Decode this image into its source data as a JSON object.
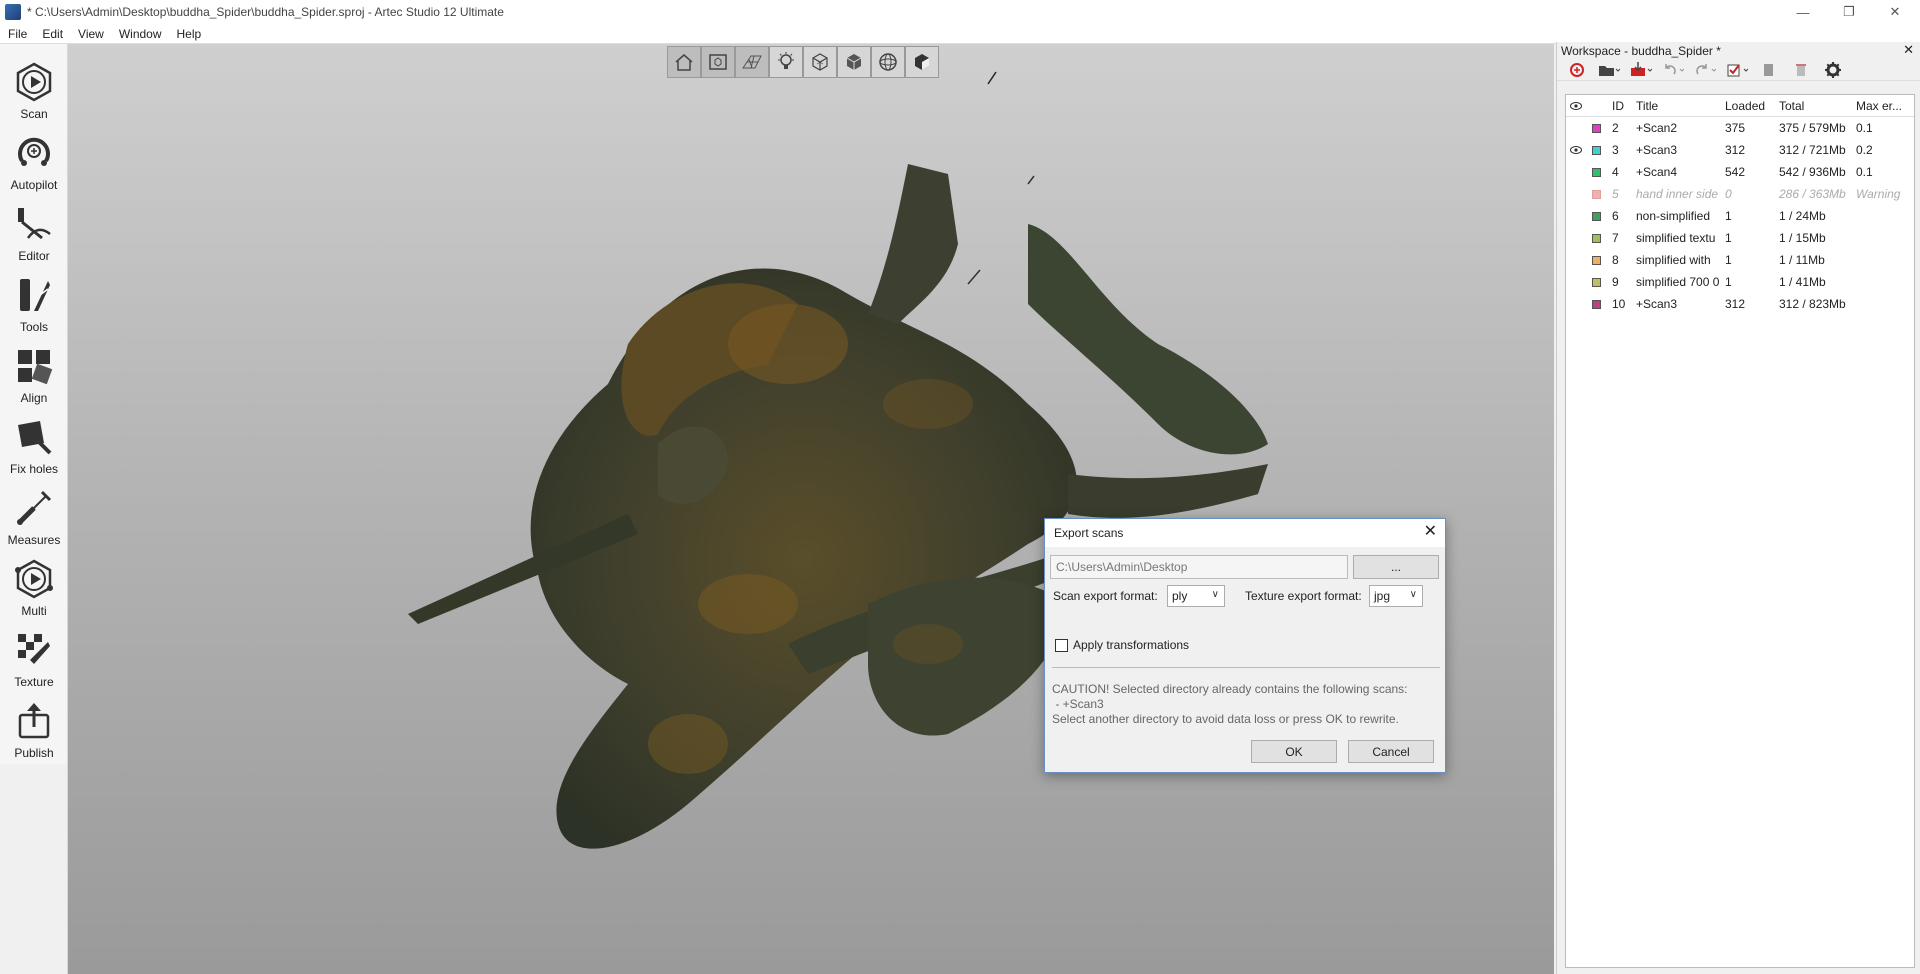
{
  "window": {
    "title": "* C:\\Users\\Admin\\Desktop\\buddha_Spider\\buddha_Spider.sproj - Artec Studio 12 Ultimate",
    "controls": [
      "—",
      "❐",
      "✕"
    ]
  },
  "menu": [
    "File",
    "Edit",
    "View",
    "Window",
    "Help"
  ],
  "tools": [
    {
      "label": "Scan",
      "icon": "scan-icon"
    },
    {
      "label": "Autopilot",
      "icon": "autopilot-icon"
    },
    {
      "label": "Editor",
      "icon": "editor-icon"
    },
    {
      "label": "Tools",
      "icon": "tools-icon"
    },
    {
      "label": "Align",
      "icon": "align-icon"
    },
    {
      "label": "Fix holes",
      "icon": "fix-holes-icon"
    },
    {
      "label": "Measures",
      "icon": "measures-icon"
    },
    {
      "label": "Multi",
      "icon": "multi-icon"
    },
    {
      "label": "Texture",
      "icon": "texture-icon"
    },
    {
      "label": "Publish",
      "icon": "publish-icon"
    }
  ],
  "view_toolbar": [
    "home-view-icon",
    "fit-view-icon",
    "grid-icon",
    "light-icon",
    "wireframe-cube-icon",
    "solid-cube-icon",
    "sphere-icon",
    "textured-cube-icon"
  ],
  "workspace": {
    "title": "Workspace - buddha_Spider *",
    "close": "✕",
    "columns": {
      "id": "ID",
      "title": "Title",
      "loaded": "Loaded",
      "total": "Total",
      "max_err": "Max er..."
    },
    "rows": [
      {
        "id": "2",
        "title": "+Scan2",
        "loaded": "375",
        "total": "375 / 579Mb",
        "max_err": "0.1",
        "color": "#e040c0",
        "visible": false,
        "disabled": false
      },
      {
        "id": "3",
        "title": "+Scan3",
        "loaded": "312",
        "total": "312 / 721Mb",
        "max_err": "0.2",
        "color": "#40d0d0",
        "visible": true,
        "disabled": false
      },
      {
        "id": "4",
        "title": "+Scan4",
        "loaded": "542",
        "total": "542 / 936Mb",
        "max_err": "0.1",
        "color": "#30c070",
        "visible": false,
        "disabled": false
      },
      {
        "id": "5",
        "title": "hand inner side",
        "loaded": "0",
        "total": "286 / 363Mb",
        "max_err": "Warning",
        "color": "#f0b0b0",
        "visible": false,
        "disabled": true
      },
      {
        "id": "6",
        "title": "non-simplified",
        "loaded": "1",
        "total": "1 / 24Mb",
        "max_err": "",
        "color": "#40a060",
        "visible": false,
        "disabled": false
      },
      {
        "id": "7",
        "title": "simplified textu",
        "loaded": "1",
        "total": "1 / 15Mb",
        "max_err": "",
        "color": "#a0c060",
        "visible": false,
        "disabled": false
      },
      {
        "id": "8",
        "title": "simplified with",
        "loaded": "1",
        "total": "1 / 11Mb",
        "max_err": "",
        "color": "#f0b060",
        "visible": false,
        "disabled": false
      },
      {
        "id": "9",
        "title": "simplified 700 0",
        "loaded": "1",
        "total": "1 / 41Mb",
        "max_err": "",
        "color": "#c0c060",
        "visible": false,
        "disabled": false
      },
      {
        "id": "10",
        "title": "+Scan3",
        "loaded": "312",
        "total": "312 / 823Mb",
        "max_err": "",
        "color": "#c04080",
        "visible": false,
        "disabled": false
      }
    ]
  },
  "dialog": {
    "title": "Export scans",
    "path": "C:\\Users\\Admin\\Desktop",
    "browse": "...",
    "scan_format_label": "Scan export format:",
    "scan_format": "ply",
    "texture_format_label": "Texture export format:",
    "texture_format": "jpg",
    "apply_transformations": "Apply transformations",
    "message": [
      "CAUTION! Selected directory already contains the following scans:",
      " - +Scan3",
      "Select another directory to avoid data loss or press OK to rewrite."
    ],
    "ok": "OK",
    "cancel": "Cancel"
  }
}
